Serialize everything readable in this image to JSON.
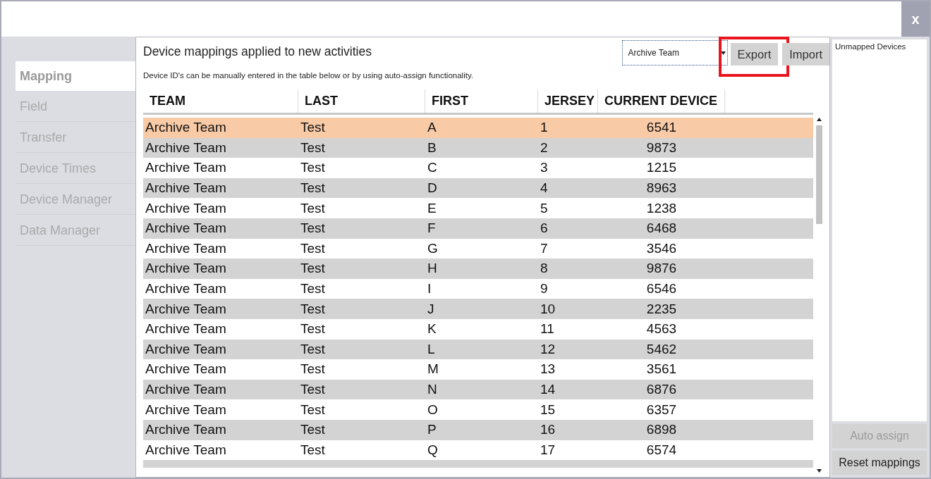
{
  "window": {
    "close": "x"
  },
  "sidebar": {
    "items": [
      {
        "label": "Mapping",
        "selected": true
      },
      {
        "label": "Field",
        "selected": false
      },
      {
        "label": "Transfer",
        "selected": false
      },
      {
        "label": "Device Times",
        "selected": false
      },
      {
        "label": "Device Manager",
        "selected": false
      },
      {
        "label": "Data Manager",
        "selected": false
      }
    ]
  },
  "main": {
    "title": "Device mappings applied to new activities",
    "subtitle": "Device ID's can be manually entered in the table below or by using auto-assign functionality.",
    "team_select": {
      "value": "Archive Team"
    },
    "buttons": [
      {
        "label": "Export",
        "highlighted": true
      },
      {
        "label": "Import",
        "highlighted": false
      }
    ]
  },
  "table": {
    "columns": [
      "TEAM",
      "LAST",
      "FIRST",
      "JERSEY",
      "CURRENT DEVICE"
    ],
    "rows": [
      {
        "cells": [
          "Archive Team",
          "Test",
          "A",
          "1",
          "6541"
        ],
        "selected": true
      },
      {
        "cells": [
          "Archive Team",
          "Test",
          "B",
          "2",
          "9873"
        ],
        "selected": false
      },
      {
        "cells": [
          "Archive Team",
          "Test",
          "C",
          "3",
          "1215"
        ],
        "selected": false
      },
      {
        "cells": [
          "Archive Team",
          "Test",
          "D",
          "4",
          "8963"
        ],
        "selected": false
      },
      {
        "cells": [
          "Archive Team",
          "Test",
          "E",
          "5",
          "1238"
        ],
        "selected": false
      },
      {
        "cells": [
          "Archive Team",
          "Test",
          "F",
          "6",
          "6468"
        ],
        "selected": false
      },
      {
        "cells": [
          "Archive Team",
          "Test",
          "G",
          "7",
          "3546"
        ],
        "selected": false
      },
      {
        "cells": [
          "Archive Team",
          "Test",
          "H",
          "8",
          "9876"
        ],
        "selected": false
      },
      {
        "cells": [
          "Archive Team",
          "Test",
          "I",
          "9",
          "6546"
        ],
        "selected": false
      },
      {
        "cells": [
          "Archive Team",
          "Test",
          "J",
          "10",
          "2235"
        ],
        "selected": false
      },
      {
        "cells": [
          "Archive Team",
          "Test",
          "K",
          "11",
          "4563"
        ],
        "selected": false
      },
      {
        "cells": [
          "Archive Team",
          "Test",
          "L",
          "12",
          "5462"
        ],
        "selected": false
      },
      {
        "cells": [
          "Archive Team",
          "Test",
          "M",
          "13",
          "3561"
        ],
        "selected": false
      },
      {
        "cells": [
          "Archive Team",
          "Test",
          "N",
          "14",
          "6876"
        ],
        "selected": false
      },
      {
        "cells": [
          "Archive Team",
          "Test",
          "O",
          "15",
          "6357"
        ],
        "selected": false
      },
      {
        "cells": [
          "Archive Team",
          "Test",
          "P",
          "16",
          "6898"
        ],
        "selected": false
      },
      {
        "cells": [
          "Archive Team",
          "Test",
          "Q",
          "17",
          "6574"
        ],
        "selected": false
      }
    ]
  },
  "right_panel": {
    "title": "Unmapped Devices",
    "buttons": [
      {
        "label": "Auto assign",
        "disabled": true
      },
      {
        "label": "Reset mappings",
        "disabled": false
      }
    ]
  }
}
